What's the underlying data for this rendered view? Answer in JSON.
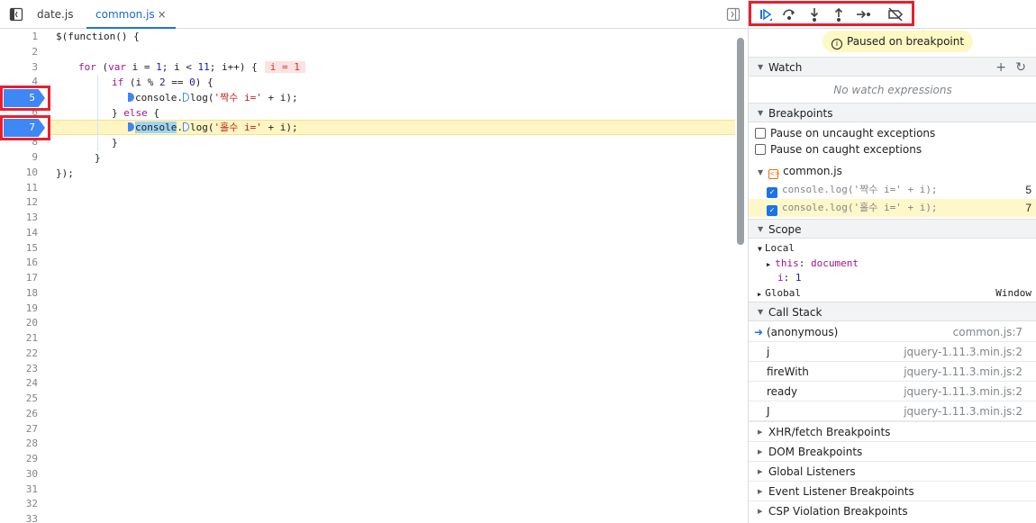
{
  "tabs": {
    "items": [
      "date.js",
      "common.js"
    ],
    "close": "×"
  },
  "gutter": {
    "lines": [
      "1",
      "2",
      "3",
      "4",
      "5",
      "6",
      "7",
      "8",
      "9",
      "10",
      "11",
      "12",
      "13",
      "14",
      "15",
      "16",
      "17",
      "18",
      "19",
      "20",
      "21",
      "22",
      "23",
      "24",
      "25",
      "26",
      "27",
      "28",
      "29",
      "30",
      "31",
      "32",
      "33"
    ],
    "bp5": "5",
    "bp7": "7"
  },
  "code": {
    "l1": "$(function() {",
    "l3a": "for",
    "l3b": " (",
    "l3c": "var",
    "l3d": " i = ",
    "l3e": "1",
    "l3f": "; i < ",
    "l3g": "11",
    "l3h": "; i++) {",
    "l3inline": "i = 1",
    "l4a": "if",
    "l4b": " (i % ",
    "l4c": "2",
    "l4d": " == ",
    "l4e": "0",
    "l4f": ") {",
    "l5a": "console.",
    "l5b": "log(",
    "l5c": "'짝수 i='",
    "l5d": " + i);",
    "l6a": "} ",
    "l6b": "else",
    "l6c": " {",
    "l7a": "console",
    "l7b": ".",
    "l7c": "log(",
    "l7d": "'홀수 i='",
    "l7e": " + i);",
    "l8": "}",
    "l9": "}",
    "l10": "});"
  },
  "debugger": {
    "paused": "Paused on breakpoint",
    "watch": {
      "title": "Watch",
      "empty": "No watch expressions"
    },
    "breakpoints": {
      "title": "Breakpoints",
      "uncaught": "Pause on uncaught exceptions",
      "caught": "Pause on caught exceptions",
      "file": "common.js",
      "items": [
        {
          "code": "console.log('짝수 i=' + i);",
          "line": "5"
        },
        {
          "code": "console.log('홀수 i=' + i);",
          "line": "7"
        }
      ]
    },
    "scope": {
      "title": "Scope",
      "local": "Local",
      "this_key": "this",
      "this_val": "document",
      "i_key": "i",
      "i_val": "1",
      "global": "Global",
      "global_val": "Window"
    },
    "callstack": {
      "title": "Call Stack",
      "frames": [
        {
          "fn": "(anonymous)",
          "loc": "common.js:7"
        },
        {
          "fn": "j",
          "loc": "jquery-1.11.3.min.js:2"
        },
        {
          "fn": "fireWith",
          "loc": "jquery-1.11.3.min.js:2"
        },
        {
          "fn": "ready",
          "loc": "jquery-1.11.3.min.js:2"
        },
        {
          "fn": "J",
          "loc": "jquery-1.11.3.min.js:2"
        }
      ]
    },
    "collapsed": [
      "XHR/fetch Breakpoints",
      "DOM Breakpoints",
      "Global Listeners",
      "Event Listener Breakpoints",
      "CSP Violation Breakpoints"
    ]
  }
}
